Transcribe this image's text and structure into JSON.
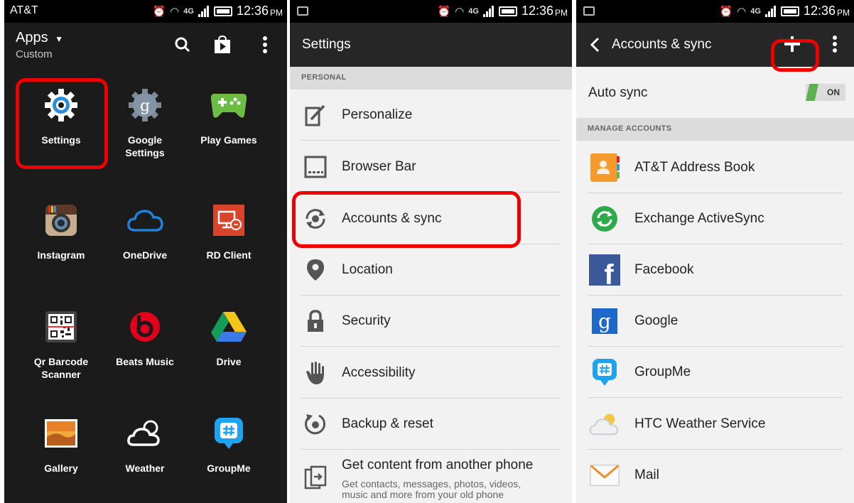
{
  "status": {
    "carrier": "AT&T",
    "time": "12:36",
    "ampm": "PM"
  },
  "apps_screen": {
    "title": "Apps",
    "subtitle": "Custom",
    "apps": [
      {
        "label": "Settings",
        "icon": "settings-gear-icon"
      },
      {
        "label": "Google\nSettings",
        "icon": "google-settings-icon"
      },
      {
        "label": "Play Games",
        "icon": "play-games-controller-icon"
      },
      {
        "label": "Instagram",
        "icon": "instagram-camera-icon"
      },
      {
        "label": "OneDrive",
        "icon": "onedrive-cloud-icon"
      },
      {
        "label": "RD Client",
        "icon": "rd-client-icon"
      },
      {
        "label": "Qr Barcode\nScanner",
        "icon": "qr-code-icon"
      },
      {
        "label": "Beats Music",
        "icon": "beats-music-icon"
      },
      {
        "label": "Drive",
        "icon": "google-drive-icon"
      },
      {
        "label": "Gallery",
        "icon": "gallery-picture-icon"
      },
      {
        "label": "Weather",
        "icon": "weather-cloud-sun-icon"
      },
      {
        "label": "GroupMe",
        "icon": "groupme-icon"
      }
    ]
  },
  "settings_screen": {
    "title": "Settings",
    "section": "PERSONAL",
    "items": [
      {
        "label": "Personalize",
        "icon": "personalize-icon"
      },
      {
        "label": "Browser Bar",
        "icon": "browser-bar-icon"
      },
      {
        "label": "Accounts & sync",
        "icon": "accounts-sync-icon"
      },
      {
        "label": "Location",
        "icon": "location-pin-icon"
      },
      {
        "label": "Security",
        "icon": "lock-icon"
      },
      {
        "label": "Accessibility",
        "icon": "hand-icon"
      },
      {
        "label": "Backup & reset",
        "icon": "backup-reset-icon"
      },
      {
        "label": "Get content from another phone",
        "sub": "Get contacts, messages, photos, videos,\nmusic and more from your old phone",
        "icon": "transfer-phone-icon"
      }
    ]
  },
  "accounts_screen": {
    "title": "Accounts & sync",
    "auto_sync_label": "Auto sync",
    "toggle_label": "ON",
    "section": "MANAGE ACCOUNTS",
    "accounts": [
      {
        "label": "AT&T Address Book",
        "icon": "address-book-icon"
      },
      {
        "label": "Exchange ActiveSync",
        "icon": "exchange-sync-icon"
      },
      {
        "label": "Facebook",
        "icon": "facebook-icon"
      },
      {
        "label": "Google",
        "icon": "google-icon"
      },
      {
        "label": "GroupMe",
        "icon": "groupme-icon"
      },
      {
        "label": "HTC Weather Service",
        "icon": "weather-cloud-icon"
      },
      {
        "label": "Mail",
        "icon": "mail-envelope-icon"
      }
    ]
  },
  "colors": {
    "highlight": "#ee0000",
    "toggle_on": "#5db24f"
  }
}
